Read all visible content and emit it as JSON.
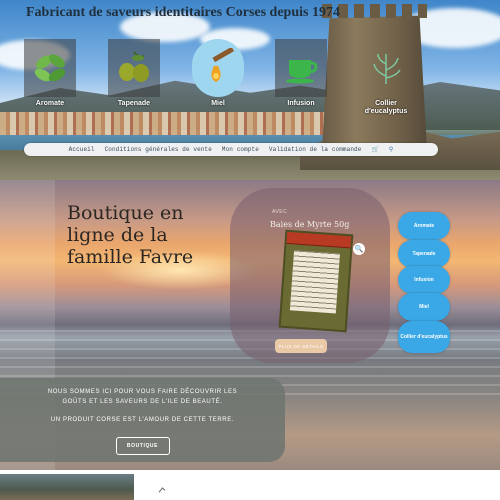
{
  "header": {
    "site_title": "Fabricant de saveurs identitaires Corses depuis 1974"
  },
  "categories": [
    {
      "label": "Aromate",
      "icon": "herb-leaves-icon"
    },
    {
      "label": "Tapenade",
      "icon": "olives-icon"
    },
    {
      "label": "Miel",
      "icon": "honey-drizzle-icon"
    },
    {
      "label": "Infusion",
      "icon": "teacup-icon"
    },
    {
      "label": "Collier d'eucalyptus",
      "icon": "eucalyptus-sprig-icon"
    }
  ],
  "nav": {
    "items": [
      "Accueil",
      "Conditions générales de vente",
      "Mon compte",
      "Validation de la commande"
    ],
    "cart_icon": "cart-icon",
    "search_icon": "search-icon"
  },
  "banner": {
    "title": "Boutique en ligne de la famille Favre",
    "product": {
      "tag": "AVEC",
      "name": "Baies de Myrte 50g",
      "button": "PLUS DE DÉTAILS"
    },
    "side_buttons": [
      "Aromate",
      "Tapenade",
      "Infusion",
      "Miel",
      "Collier d'eucalyptus"
    ],
    "intro": {
      "line1": "NOUS SOMMES ICI POUR VOUS FAIRE DÉCOUVRIR LES",
      "line2": "GOÛTS ET LES SAVEURS DE L'ILE DE BEAUTÉ.",
      "line3": "UN PRODUIT CORSE EST L'AMOUR DE CETTE TERRE.",
      "button": "BOUTIQUE"
    }
  },
  "colors": {
    "accent_blue": "#3aa8e6",
    "title_dark": "#1f2f3d",
    "intro_panel": "#6e7570"
  }
}
